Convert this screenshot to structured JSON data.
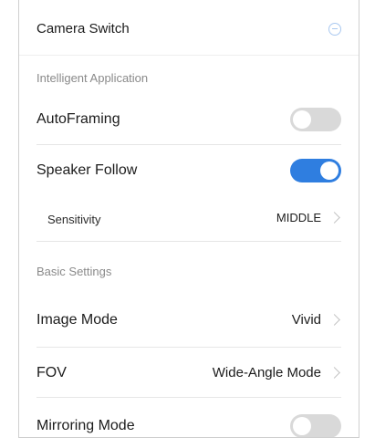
{
  "camera_switch": {
    "label": "Camera Switch",
    "icon": "minus-circle-icon"
  },
  "sections": {
    "intelligent": "Intelligent Application",
    "basic": "Basic Settings"
  },
  "settings": {
    "autoframing": {
      "label": "AutoFraming",
      "enabled": false
    },
    "speaker_follow": {
      "label": "Speaker Follow",
      "enabled": true
    },
    "sensitivity": {
      "label": "Sensitivity",
      "value": "MIDDLE"
    },
    "image_mode": {
      "label": "Image Mode",
      "value": "Vivid"
    },
    "fov": {
      "label": "FOV",
      "value": "Wide-Angle Mode"
    },
    "mirroring": {
      "label": "Mirroring Mode",
      "enabled": false
    }
  },
  "colors": {
    "accent": "#2f7ee0",
    "toggle_off": "#d9d9d9",
    "section_text": "#8a8a8a",
    "divider": "#e6e6e6"
  }
}
